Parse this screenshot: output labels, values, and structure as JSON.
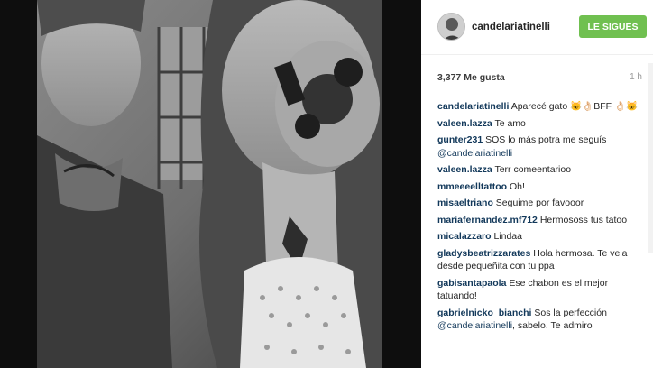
{
  "post": {
    "username": "candelariatinelli",
    "follow_label": "LE SIGUES",
    "likes": "3,377 Me gusta",
    "time": "1 h"
  },
  "comments": [
    {
      "user": "candelariatinelli",
      "text": "Aparecé gato 🐱👌🏻BFF 👌🏻🐱"
    },
    {
      "user": "valeen.lazza",
      "text": "Te amo"
    },
    {
      "user": "gunter231",
      "text": "SOS lo más potra me seguís",
      "mention": "@candelariatinelli"
    },
    {
      "user": "valeen.lazza",
      "text": "Terr comeentarioo"
    },
    {
      "user": "mmeeeelltattoo",
      "text": "Oh!"
    },
    {
      "user": "misaeltriano",
      "text": "Seguime por favooor"
    },
    {
      "user": "mariafernandez.mf712",
      "text": "Hermososs tus tatoo"
    },
    {
      "user": "micalazzaro",
      "text": "Lindaa"
    },
    {
      "user": "gladysbeatrizzarates",
      "text": "Hola hermosa. Te veia desde pequeñita con tu ppa"
    },
    {
      "user": "gabisantapaola",
      "text": "Ese chabon es el mejor tatuando!"
    },
    {
      "user": "gabrielnicko_bianchi",
      "text": "Sos la perfección",
      "mention": "@candelariatinelli",
      "tail": ", sabelo. Te admiro"
    }
  ]
}
